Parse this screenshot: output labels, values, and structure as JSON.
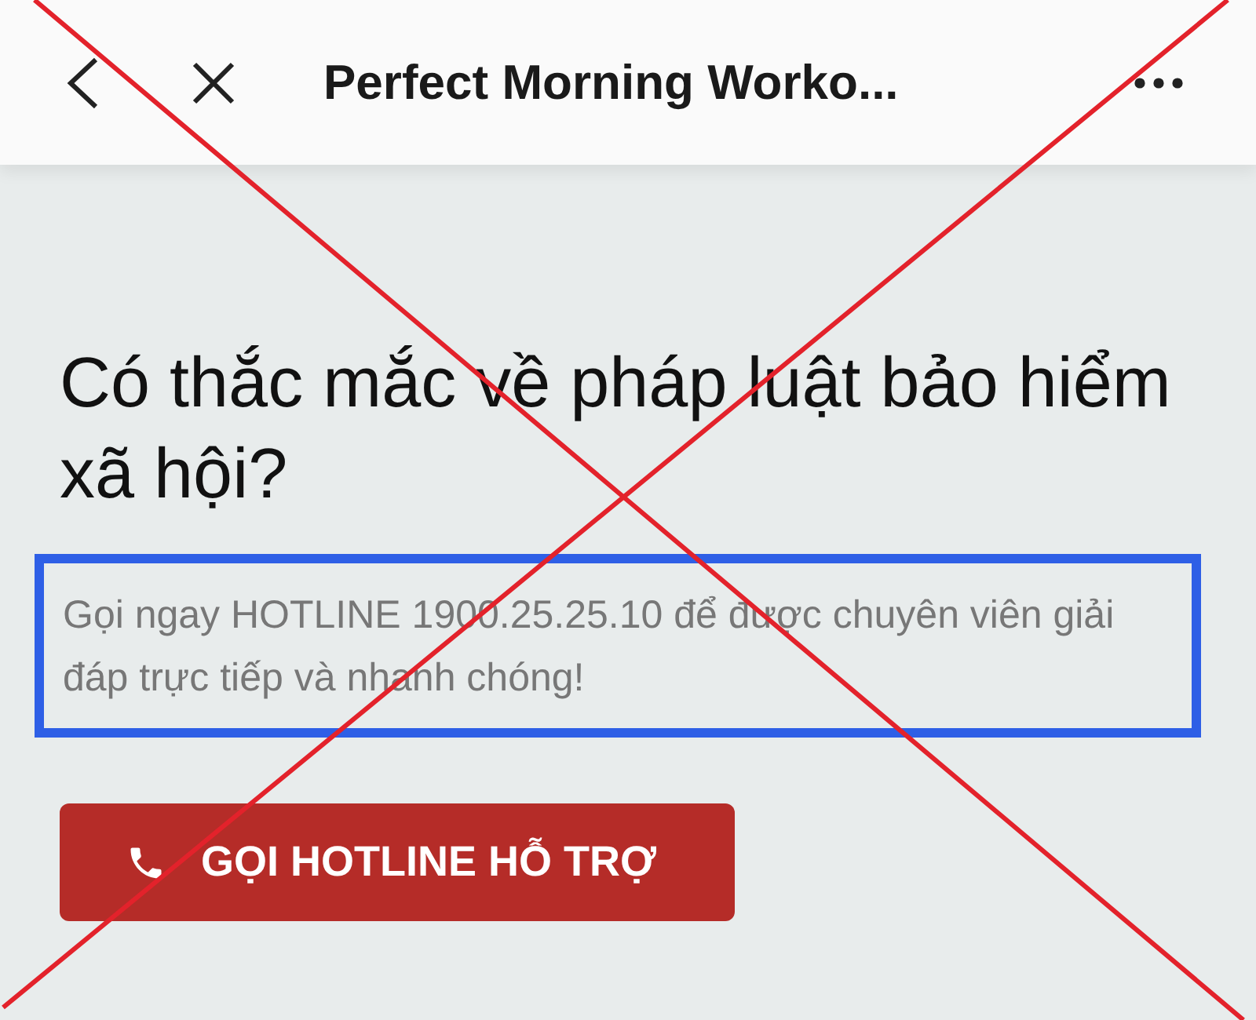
{
  "toolbar": {
    "title": "Perfect Morning Worko..."
  },
  "heading": "Có thắc mắc về pháp luật bảo hiểm xã hội?",
  "highlighted_text": "Gọi ngay HOTLINE 1900.25.25.10 để được chuyên viên giải đáp trực tiếp và nhanh chóng!",
  "button": {
    "label": "GỌI HOTLINE HỖ TRỢ"
  }
}
